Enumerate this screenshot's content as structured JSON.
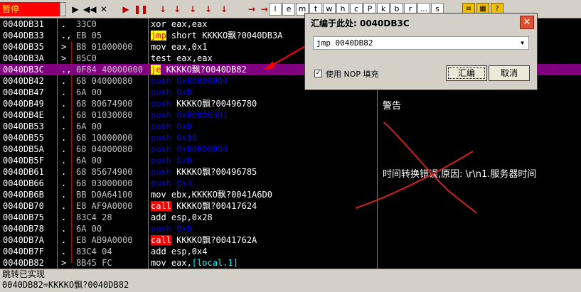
{
  "toolbar": {
    "status": "暂停",
    "buttons": [
      "▶",
      "◀◀",
      "✕",
      "▶",
      "❚❚",
      "↓",
      "↓",
      "↓",
      "↓",
      "↓",
      "→",
      "→|"
    ],
    "letters": [
      "l",
      "e",
      "m",
      "t",
      "w",
      "h",
      "c",
      "P",
      "k",
      "b",
      "r",
      "...",
      "s"
    ]
  },
  "rows": [
    {
      "addr": "0040DB31",
      "mark": ".",
      "hex": "33C0",
      "parts": [
        [
          "w",
          "xor eax,eax"
        ]
      ]
    },
    {
      "addr": "0040DB33",
      "mark": ".,",
      "hex": "EB 05",
      "parts": [
        [
          "kw-jmp",
          "jmp"
        ],
        [
          "w",
          " short KKKKO飘?0040DB3A"
        ]
      ]
    },
    {
      "addr": "0040DB35",
      "mark": ">",
      "hex": "B8 01000000",
      "parts": [
        [
          "w",
          "mov eax,0x1"
        ]
      ]
    },
    {
      "addr": "0040DB3A",
      "mark": ">",
      "hex": "85C0",
      "parts": [
        [
          "w",
          "test eax,eax"
        ]
      ]
    },
    {
      "addr": "0040DB3C",
      "mark": ".,",
      "hex": "0F84 40000000",
      "parts": [
        [
          "kw-je",
          "je"
        ],
        [
          "w",
          " KKKKO飘?0040DB82"
        ]
      ],
      "selected": true
    },
    {
      "addr": "0040DB42",
      "mark": ".",
      "hex": "68 04000080",
      "parts": [
        [
          "b",
          "push 0x80000004"
        ]
      ]
    },
    {
      "addr": "0040DB47",
      "mark": ".",
      "hex": "6A 00",
      "parts": [
        [
          "b",
          "push 0x0"
        ]
      ]
    },
    {
      "addr": "0040DB49",
      "mark": ".",
      "hex": "68 80674900",
      "parts": [
        [
          "b",
          "push "
        ],
        [
          "w",
          "KKKKO飘?00496780"
        ]
      ]
    },
    {
      "addr": "0040DB4E",
      "mark": ".",
      "hex": "68 01030080",
      "parts": [
        [
          "b",
          "push 0x80000301"
        ]
      ]
    },
    {
      "addr": "0040DB53",
      "mark": ".",
      "hex": "6A 00",
      "parts": [
        [
          "b",
          "push 0x0"
        ]
      ]
    },
    {
      "addr": "0040DB55",
      "mark": ".",
      "hex": "68 10000000",
      "parts": [
        [
          "b",
          "push 0x10"
        ]
      ]
    },
    {
      "addr": "0040DB5A",
      "mark": ".",
      "hex": "68 04000080",
      "parts": [
        [
          "b",
          "push 0x80000004"
        ]
      ]
    },
    {
      "addr": "0040DB5F",
      "mark": ".",
      "hex": "6A 00",
      "parts": [
        [
          "b",
          "push 0x0"
        ]
      ]
    },
    {
      "addr": "0040DB61",
      "mark": ".",
      "hex": "68 85674900",
      "parts": [
        [
          "b",
          "push "
        ],
        [
          "w",
          "KKKKO飘?00496785"
        ]
      ]
    },
    {
      "addr": "0040DB66",
      "mark": ".",
      "hex": "68 03000000",
      "parts": [
        [
          "b",
          "push 0x3"
        ]
      ]
    },
    {
      "addr": "0040DB6B",
      "mark": ".",
      "hex": "BB D0A64100",
      "parts": [
        [
          "w",
          "mov ebx,KKKKO飘?0041A6D0"
        ]
      ]
    },
    {
      "addr": "0040DB70",
      "mark": ".",
      "hex": "E8 AF9A0000",
      "parts": [
        [
          "kw-call",
          "call"
        ],
        [
          "w",
          " KKKKO飘?00417624"
        ]
      ]
    },
    {
      "addr": "0040DB75",
      "mark": ".",
      "hex": "83C4 28",
      "parts": [
        [
          "w",
          "add esp,0x28"
        ]
      ]
    },
    {
      "addr": "0040DB78",
      "mark": ".",
      "hex": "6A 00",
      "parts": [
        [
          "b",
          "push 0x0"
        ]
      ]
    },
    {
      "addr": "0040DB7A",
      "mark": ".",
      "hex": "E8 AB9A0000",
      "parts": [
        [
          "kw-call",
          "call"
        ],
        [
          "w",
          " KKKKO飘?0041762A"
        ]
      ]
    },
    {
      "addr": "0040DB7F",
      "mark": ".",
      "hex": "83C4 04",
      "parts": [
        [
          "w",
          "add esp,0x4"
        ]
      ]
    },
    {
      "addr": "0040DB82",
      "mark": ">",
      "hex": "8B45 FC",
      "parts": [
        [
          "w",
          "mov eax,"
        ],
        [
          "br",
          "[local.1]"
        ]
      ]
    }
  ],
  "comments": {
    "warning": "警告",
    "error": "时间转换错误,原因: \\r\\n1.服务器时间"
  },
  "info": {
    "line1": "跳转已实现",
    "line2": "0040DB82=KKKKO飘?0040DB82"
  },
  "dialog": {
    "title": "汇编于此处: 0040DB3C",
    "input_value": "jmp 0040DB82",
    "checkbox_checked": true,
    "checkbox_label": "使用 NOP 填充",
    "assemble_label": "汇编",
    "cancel_label": "取消",
    "close_glyph": "✕"
  },
  "colors": {
    "selected_row": "#800080",
    "annotation": "#ff0000"
  }
}
